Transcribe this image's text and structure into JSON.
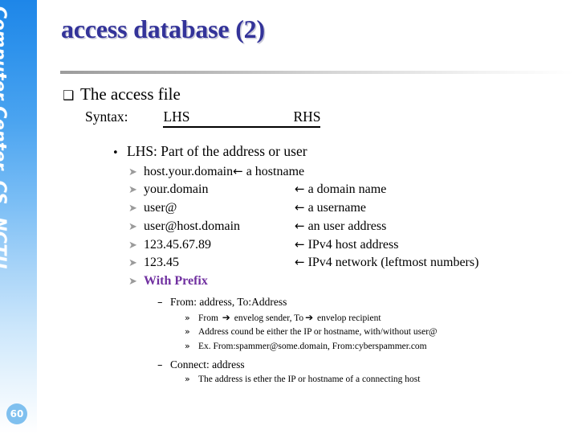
{
  "sidebar": {
    "vertical_label": "Computer Center, CS, NCTU",
    "page_number": "60"
  },
  "title": "access database (2)",
  "content": {
    "heading": {
      "marker": "❑",
      "text": "The access file"
    },
    "syntax": {
      "label": "Syntax:",
      "lhs": "LHS",
      "rhs": "RHS"
    },
    "lhs_bullet": {
      "marker": "•",
      "text": "LHS: Part of the address or user"
    },
    "lhs_items": [
      {
        "marker": "➤",
        "term": "host.your.domain",
        "arrow": "←",
        "desc": "a hostname",
        "wide": false
      },
      {
        "marker": "➤",
        "term": "your.domain",
        "arrow": "←",
        "desc": "a domain name",
        "wide": true
      },
      {
        "marker": "➤",
        "term": "user@",
        "arrow": "←",
        "desc": "a username",
        "wide": true
      },
      {
        "marker": "➤",
        "term": "user@host.domain",
        "arrow": "←",
        "desc": "an user address",
        "wide": true
      },
      {
        "marker": "➤",
        "term": "123.45.67.89",
        "arrow": "←",
        "desc": "IPv4 host address",
        "wide": true
      },
      {
        "marker": "➤",
        "term": "123.45",
        "arrow": "←",
        "desc": "IPv4 network (leftmost numbers)",
        "wide": true
      },
      {
        "marker": "➤",
        "term": "With Prefix",
        "arrow": "",
        "desc": "",
        "wide": false,
        "accent": true
      }
    ],
    "prefix_groups": [
      {
        "marker": "–",
        "title": "From: address, To:Address",
        "items": [
          {
            "marker": "»",
            "parts": [
              "From ",
              "➔",
              " envelog sender, To",
              "➔",
              " envelop recipient"
            ]
          },
          {
            "marker": "»",
            "parts": [
              "Address cound be either the IP or hostname, with/without user@"
            ]
          },
          {
            "marker": "»",
            "parts": [
              "Ex. From:spammer@some.domain, From:cyberspammer.com"
            ]
          }
        ]
      },
      {
        "marker": "–",
        "title": "Connect: address",
        "items": [
          {
            "marker": "»",
            "parts": [
              "The address is ether the IP or hostname of a connecting host"
            ]
          }
        ]
      }
    ]
  },
  "colors": {
    "title": "#333399",
    "accent": "#7030a0",
    "sidebar_top": "#1e86e8",
    "badge": "#7fc0ef"
  }
}
